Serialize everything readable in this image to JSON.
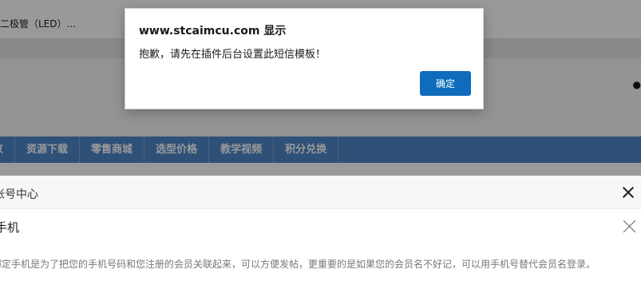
{
  "browser": {
    "tab_title": "二极管（LED）..."
  },
  "nav": {
    "items": [
      {
        "label": "京"
      },
      {
        "label": "资源下载"
      },
      {
        "label": "零售商城"
      },
      {
        "label": "选型价格"
      },
      {
        "label": "教学视频"
      },
      {
        "label": "积分兑换"
      }
    ]
  },
  "panel": {
    "header_title": "帐号中心",
    "sub_title": "手机",
    "description": "绑定手机是为了把您的手机号码和您注册的会员关联起来，可以方便发帖，更重要的是如果您的会员名不好记，可以用手机号替代会员名登录。"
  },
  "dialog": {
    "title": "www.stcaimcu.com 显示",
    "message": "抱歉，请先在插件后台设置此短信模板！",
    "ok_label": "确定"
  },
  "colors": {
    "nav_bg": "#4f87c8",
    "ok_button": "#0f6cbd",
    "overlay": "rgba(0,0,0,0.4)"
  }
}
